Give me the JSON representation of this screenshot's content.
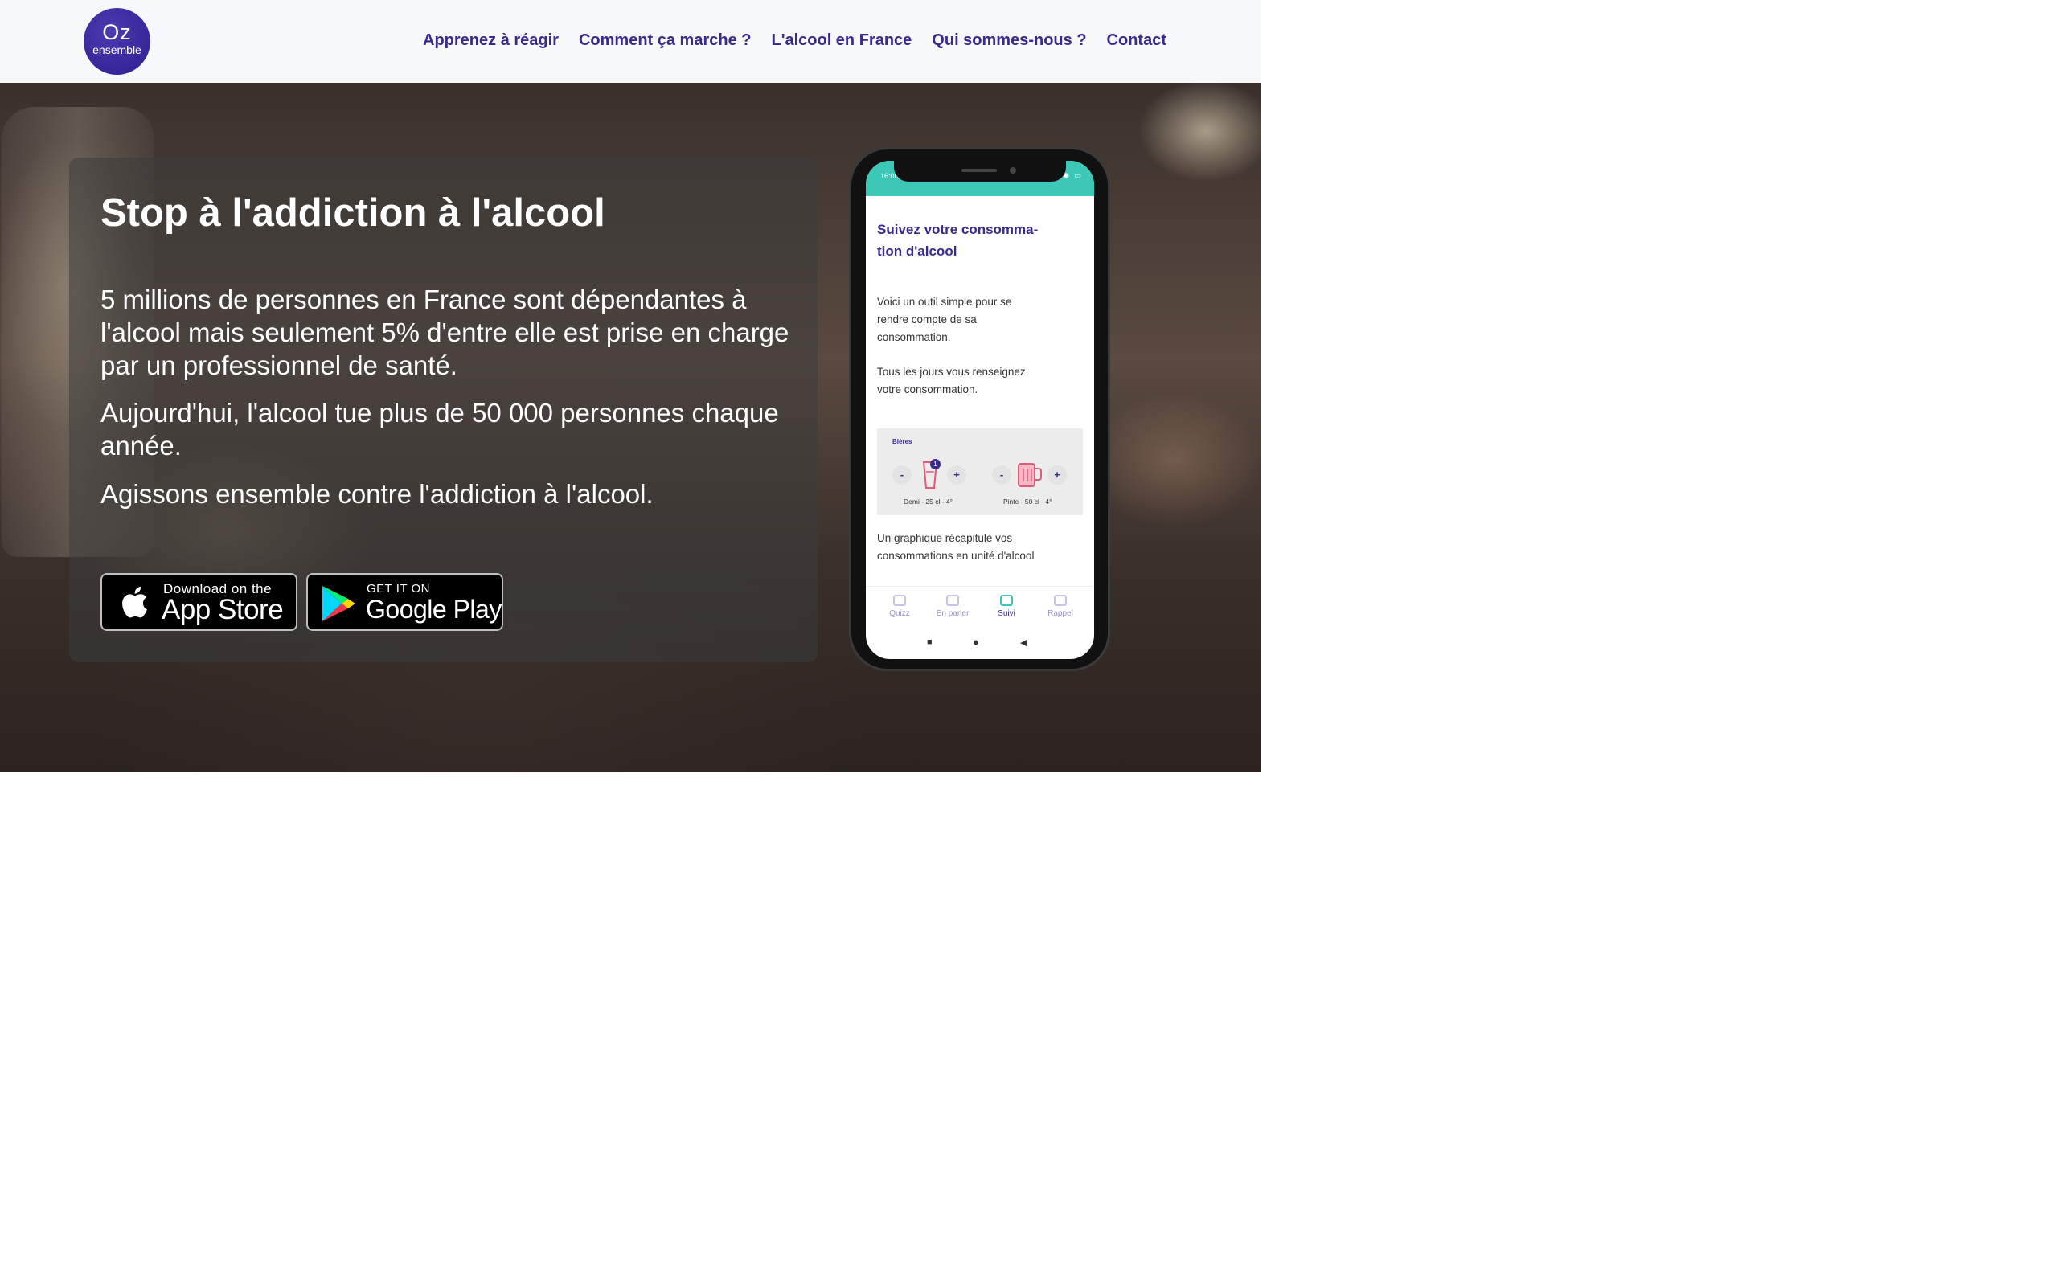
{
  "header": {
    "logo_line1": "Oz",
    "logo_line2": "ensemble",
    "nav": [
      "Apprenez à réagir",
      "Comment ça marche ?",
      "L'alcool en France",
      "Qui sommes-nous ?",
      "Contact"
    ]
  },
  "hero": {
    "title": "Stop à l'addiction à l'alcool",
    "paragraphs": [
      "5 millions de personnes en France sont dépendantes à l'alcool mais seulement 5% d'entre elle est prise en charge par un professionnel de santé.",
      "Aujourd'hui, l'alcool tue plus de 50 000 personnes chaque année.",
      "Agissons ensemble contre l'addiction à l'alcool."
    ],
    "appstore": {
      "small": "Download on the",
      "big": "App Store"
    },
    "googleplay": {
      "small": "GET IT ON",
      "big": "Google Play"
    }
  },
  "phone": {
    "time": "16:06",
    "title": "Suivez votre consomma-tion d'alcool",
    "text1": "Voici un outil simple pour se rendre compte de sa consommation.",
    "text2": "Tous les jours vous renseignez votre consommation.",
    "drinks_label": "Bières",
    "minus": "-",
    "plus": "+",
    "badge": "1",
    "drink1": "Demi - 25 cl - 4°",
    "drink2": "Pinte - 50 cl - 4°",
    "text3": "Un graphique récapitule vos consommations en unité d'alcool",
    "tabs": [
      "Quizz",
      "En parler",
      "Suivi",
      "Rappel"
    ],
    "nav_square": "■",
    "nav_circle": "●",
    "nav_back": "◀"
  },
  "colors": {
    "brand_purple": "#3b2a8e",
    "teal": "#3cc7b6",
    "header_bg": "#f7f8fa"
  }
}
